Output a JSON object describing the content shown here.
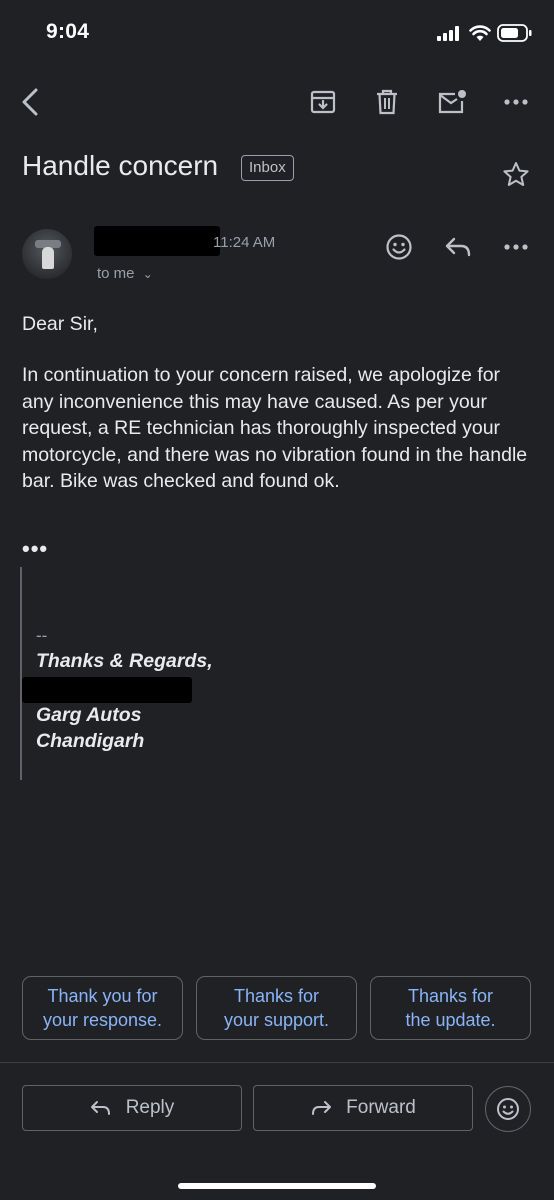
{
  "status_bar": {
    "time": "9:04"
  },
  "toolbar": {
    "icons": [
      "back-arrow-icon",
      "archive-icon",
      "delete-icon",
      "mark-unread-icon",
      "more-icon"
    ]
  },
  "email": {
    "subject": "Handle concern",
    "label": "Inbox",
    "sender_time": "11:24 AM",
    "recipient": "to me",
    "greeting": "Dear Sir,",
    "body": "In continuation to your concern raised, we apologize for any inconvenience this may have caused. As per your request, a RE technician has thoroughly inspected your motorcycle, and there was no vibration found in the handle bar. Bike was checked and found ok.",
    "more_indicator": "•••",
    "signature": {
      "dash": "--",
      "closing": "Thanks & Regards,",
      "company": "Garg Autos",
      "city": "Chandigarh"
    }
  },
  "smart_replies": [
    {
      "line1": "Thank you for",
      "line2": "your response."
    },
    {
      "line1": "Thanks for",
      "line2": "your support."
    },
    {
      "line1": "Thanks for",
      "line2": "the update."
    }
  ],
  "actions": {
    "reply_label": "Reply",
    "forward_label": "Forward"
  },
  "colors": {
    "background": "#202124",
    "text": "#e8eaed",
    "secondary_text": "#9aa0a6",
    "accent": "#8ab4f8",
    "border": "#5f6368"
  }
}
